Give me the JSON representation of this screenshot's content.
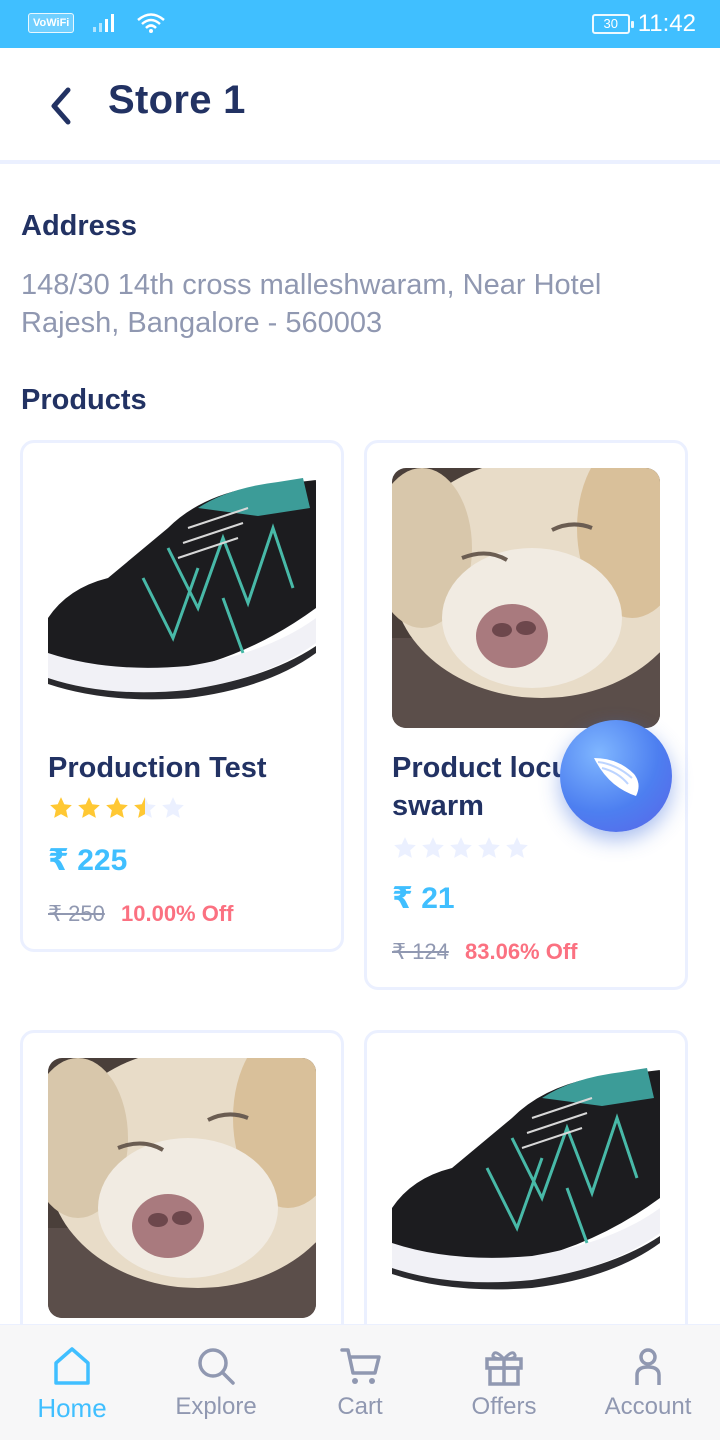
{
  "status_bar": {
    "network_badge": "VoWiFi",
    "battery_level": "30",
    "time": "11:42"
  },
  "header": {
    "title": "Store 1"
  },
  "address": {
    "heading": "Address",
    "text": "148/30 14th cross malleshwaram, Near Hotel Rajesh, Bangalore - 560003"
  },
  "products": {
    "heading": "Products",
    "items": [
      {
        "name": "Production Test",
        "rating": 3.5,
        "rating_max": 5,
        "price": "₹ 225",
        "old_price": "₹ 250",
        "discount": "10.00% Off",
        "image": "sneaker"
      },
      {
        "name": "Product locust swarm",
        "rating": 0,
        "rating_max": 5,
        "price": "₹ 21",
        "old_price": "₹ 124",
        "discount": "83.06% Off",
        "image": "dog"
      },
      {
        "name": "",
        "image": "dog"
      },
      {
        "name": "",
        "image": "sneaker"
      }
    ]
  },
  "fab": {
    "icon": "wing-icon"
  },
  "bottom_nav": {
    "active_index": 0,
    "items": [
      {
        "label": "Home",
        "icon": "home-icon"
      },
      {
        "label": "Explore",
        "icon": "search-icon"
      },
      {
        "label": "Cart",
        "icon": "cart-icon"
      },
      {
        "label": "Offers",
        "icon": "gift-icon"
      },
      {
        "label": "Account",
        "icon": "user-icon"
      }
    ]
  },
  "colors": {
    "primary": "#40bfff",
    "dark": "#223263",
    "grey": "#9098b1",
    "discount": "#fb7181",
    "star": "#ffc833",
    "star_empty": "#ebf0ff",
    "border": "#ebf0ff"
  }
}
